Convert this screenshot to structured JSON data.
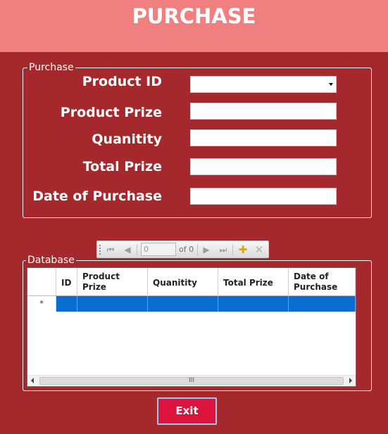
{
  "window": {
    "title": "PURCHASE"
  },
  "purchase_group": {
    "label": "Purchase",
    "fields": {
      "product_id": {
        "label": "Product ID",
        "value": ""
      },
      "product_prize": {
        "label": "Product Prize",
        "value": ""
      },
      "quanitity": {
        "label": "Quanitity",
        "value": ""
      },
      "total_prize": {
        "label": "Total Prize",
        "value": ""
      },
      "date_of_purchase": {
        "label": "Date of Purchase",
        "value": ""
      }
    }
  },
  "database_group": {
    "label": "Database",
    "navigator": {
      "position": "0",
      "of_text": "of 0"
    },
    "columns": [
      "ID",
      "Product Prize",
      "Quanitity",
      "Total Prize",
      "Date of Purchase"
    ],
    "new_row_marker": "*",
    "scrollbar_grip": "III"
  },
  "buttons": {
    "exit": "Exit"
  },
  "colors": {
    "background": "#a5292c",
    "header": "#f08080",
    "selected_row": "#0a6ed1",
    "exit_button": "#dc143c"
  }
}
